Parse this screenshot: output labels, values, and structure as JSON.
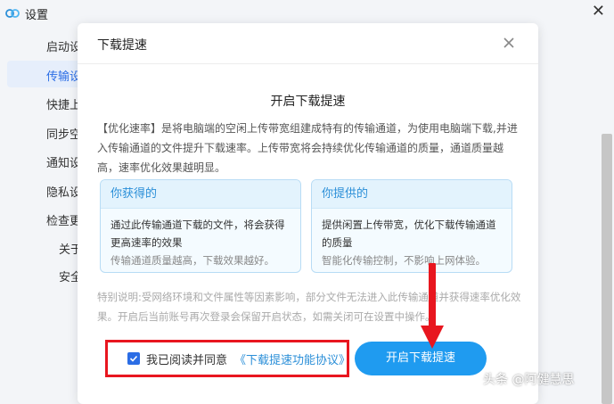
{
  "app": {
    "title": "设置",
    "close_glyph": "✕"
  },
  "sidebar": {
    "items": [
      {
        "label": "启动设",
        "active": false
      },
      {
        "label": "传输设",
        "active": true
      },
      {
        "label": "快捷上",
        "active": false
      },
      {
        "label": "同步空",
        "active": false
      },
      {
        "label": "通知设",
        "active": false
      },
      {
        "label": "隐私设",
        "active": false
      },
      {
        "label": "检查更",
        "active": false
      }
    ],
    "sub_items": [
      {
        "label": "关于"
      },
      {
        "label": "安全"
      }
    ]
  },
  "dialog": {
    "title": "下载提速",
    "heading": "开启下载提速",
    "description": "【优化速率】是将电脑端的空闲上传带宽组建成特有的传输通道，为使用电脑端下载,并进入传输通道的文件提升下载速率。上传带宽将会持续优化传输通道的质量，通道质量越高，速率优化效果越明显。",
    "cards": [
      {
        "title": "你获得的",
        "line1": "通过此传输通道下载的文件，将会获得更高速率的效果",
        "line2": "传输通道质量越高，下载效果越好。"
      },
      {
        "title": "你提供的",
        "line1": "提供闲置上传带宽，优化下载传输通道的质量",
        "line2": "智能化传输控制，不影响上网体验。"
      }
    ],
    "note": "特别说明:受网络环境和文件属性等因素影响，部分文件无法进入此传输通道并获得速率优化效果。开启后当前账号再次登录会保留开启状态，如需关闭可在设置中操作。",
    "agree_text": "我已阅读并同意",
    "agree_link": "《下载提速功能协议》",
    "agree_checked": true,
    "primary_button": "开启下载提速"
  },
  "watermark": "头条 @阿健慧思",
  "colors": {
    "accent": "#2b6de5",
    "button": "#1f9bf0",
    "highlight_red": "#e8161f",
    "card_title": "#2b8fd8"
  }
}
